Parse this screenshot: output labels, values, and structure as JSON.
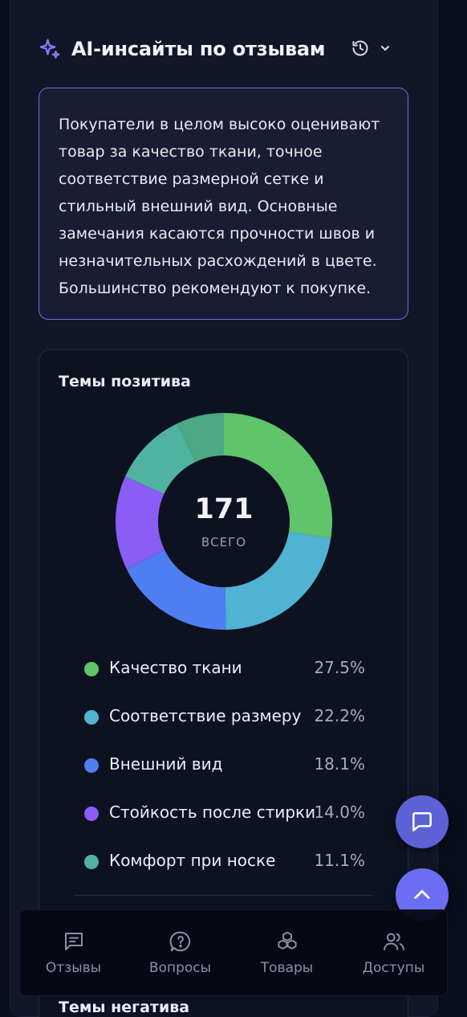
{
  "header": {
    "title": "AI-инсайты по отзывам",
    "icons": [
      "sparkle-icon",
      "history-icon",
      "chevron-down-icon"
    ]
  },
  "summary": {
    "text": "Покупатели в целом высоко оценивают товар за качество ткани, точное соответствие размерной сетке и стильный внешний вид. Основные замечания касаются прочности швов и незначительных расхождений в цвете. Большинство рекомендуют к покупке."
  },
  "positive": {
    "title": "Темы позитива",
    "total": "171",
    "total_label": "ВСЕГО",
    "items": [
      {
        "label": "Качество ткани",
        "pct": "27.5%",
        "color": "#5fc46a"
      },
      {
        "label": "Соответствие размеру",
        "pct": "22.2%",
        "color": "#4fb3d1"
      },
      {
        "label": "Внешний вид",
        "pct": "18.1%",
        "color": "#4f7ef0"
      },
      {
        "label": "Стойкость после стирки",
        "pct": "14.0%",
        "color": "#8b5cf6"
      },
      {
        "label": "Комфорт при носке",
        "pct": "11.1%",
        "color": "#4fb3a0"
      }
    ]
  },
  "chart_data": {
    "type": "pie",
    "title": "Темы позитива",
    "total": 171,
    "categories": [
      "Качество ткани",
      "Соответствие размеру",
      "Внешний вид",
      "Стойкость после стирки",
      "Комфорт при носке",
      ""
    ],
    "values": [
      27.5,
      22.2,
      18.1,
      14.0,
      11.1,
      7.1
    ],
    "colors": [
      "#5fc46a",
      "#4fb3d1",
      "#4f7ef0",
      "#8b5cf6",
      "#4fb3a0",
      "#4aa884"
    ],
    "donut": true
  },
  "negative": {
    "title": "Темы негатива"
  },
  "nav": {
    "items": [
      {
        "label": "Отзывы",
        "icon": "reviews-icon"
      },
      {
        "label": "Вопросы",
        "icon": "questions-icon"
      },
      {
        "label": "Товары",
        "icon": "products-icon"
      },
      {
        "label": "Доступы",
        "icon": "access-icon"
      }
    ]
  },
  "colors": {
    "accent": "#6b6ef2",
    "panel": "#111728",
    "summary_border": "#6f6fe0"
  }
}
